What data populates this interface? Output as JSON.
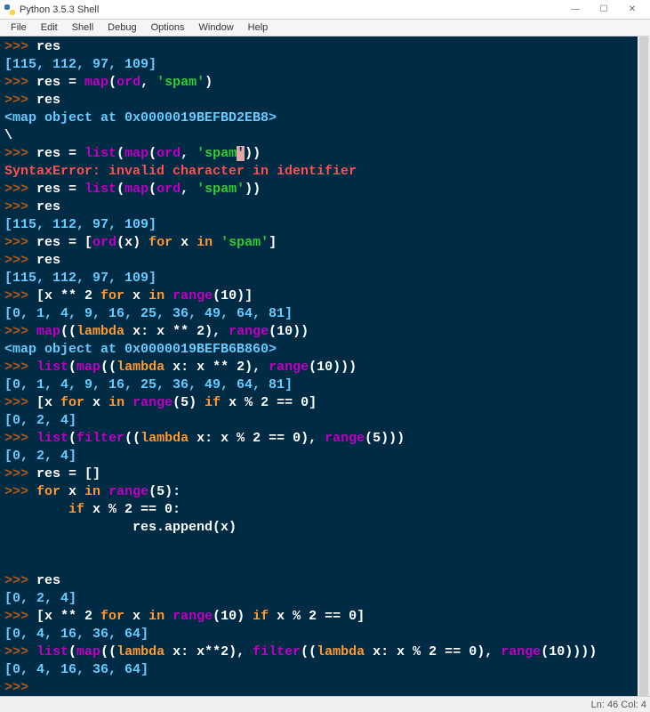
{
  "window": {
    "title": "Python 3.5.3 Shell",
    "min": "—",
    "max": "☐",
    "close": "✕"
  },
  "menu": {
    "file": "File",
    "edit": "Edit",
    "shell": "Shell",
    "debug": "Debug",
    "options": "Options",
    "window": "Window",
    "help": "Help"
  },
  "status": {
    "pos": "Ln: 46   Col: 4"
  },
  "lines": [
    [
      {
        "c": "p",
        "t": ">>> "
      },
      {
        "c": "id",
        "t": "res"
      }
    ],
    [
      {
        "c": "nn",
        "t": "[115, 112, 97, 109]"
      }
    ],
    [
      {
        "c": "p",
        "t": ">>> "
      },
      {
        "c": "id",
        "t": "res "
      },
      {
        "c": "op",
        "t": "= "
      },
      {
        "c": "fn",
        "t": "map"
      },
      {
        "c": "op",
        "t": "("
      },
      {
        "c": "fn",
        "t": "ord"
      },
      {
        "c": "op",
        "t": ", "
      },
      {
        "c": "st",
        "t": "'spam'"
      },
      {
        "c": "op",
        "t": ")"
      }
    ],
    [
      {
        "c": "p",
        "t": ">>> "
      },
      {
        "c": "id",
        "t": "res"
      }
    ],
    [
      {
        "c": "nn",
        "t": "<map object at 0x0000019BEFBD2EB8>"
      }
    ],
    [
      {
        "c": "id",
        "t": "\\"
      }
    ],
    [
      {
        "c": "p",
        "t": ">>> "
      },
      {
        "c": "id",
        "t": "res "
      },
      {
        "c": "op",
        "t": "= "
      },
      {
        "c": "fn",
        "t": "list"
      },
      {
        "c": "op",
        "t": "("
      },
      {
        "c": "fn",
        "t": "map"
      },
      {
        "c": "op",
        "t": "("
      },
      {
        "c": "fn",
        "t": "ord"
      },
      {
        "c": "op",
        "t": ", "
      },
      {
        "c": "st",
        "t": "'spam"
      },
      {
        "c": "cu",
        "t": "'"
      },
      {
        "c": "op",
        "t": "))"
      }
    ],
    [
      {
        "c": "er",
        "t": "SyntaxError: invalid character in identifier"
      }
    ],
    [
      {
        "c": "p",
        "t": ">>> "
      },
      {
        "c": "id",
        "t": "res "
      },
      {
        "c": "op",
        "t": "= "
      },
      {
        "c": "fn",
        "t": "list"
      },
      {
        "c": "op",
        "t": "("
      },
      {
        "c": "fn",
        "t": "map"
      },
      {
        "c": "op",
        "t": "("
      },
      {
        "c": "fn",
        "t": "ord"
      },
      {
        "c": "op",
        "t": ", "
      },
      {
        "c": "st",
        "t": "'spam'"
      },
      {
        "c": "op",
        "t": "))"
      }
    ],
    [
      {
        "c": "p",
        "t": ">>> "
      },
      {
        "c": "id",
        "t": "res"
      }
    ],
    [
      {
        "c": "nn",
        "t": "[115, 112, 97, 109]"
      }
    ],
    [
      {
        "c": "p",
        "t": ">>> "
      },
      {
        "c": "id",
        "t": "res "
      },
      {
        "c": "op",
        "t": "= ["
      },
      {
        "c": "fn",
        "t": "ord"
      },
      {
        "c": "op",
        "t": "(x) "
      },
      {
        "c": "kw",
        "t": "for"
      },
      {
        "c": "op",
        "t": " x "
      },
      {
        "c": "kw",
        "t": "in"
      },
      {
        "c": "op",
        "t": " "
      },
      {
        "c": "st",
        "t": "'spam'"
      },
      {
        "c": "op",
        "t": "]"
      }
    ],
    [
      {
        "c": "p",
        "t": ">>> "
      },
      {
        "c": "id",
        "t": "res"
      }
    ],
    [
      {
        "c": "nn",
        "t": "[115, 112, 97, 109]"
      }
    ],
    [
      {
        "c": "p",
        "t": ">>> "
      },
      {
        "c": "op",
        "t": "[x ** 2 "
      },
      {
        "c": "kw",
        "t": "for"
      },
      {
        "c": "op",
        "t": " x "
      },
      {
        "c": "kw",
        "t": "in"
      },
      {
        "c": "op",
        "t": " "
      },
      {
        "c": "fn",
        "t": "range"
      },
      {
        "c": "op",
        "t": "(10)]"
      }
    ],
    [
      {
        "c": "nn",
        "t": "[0, 1, 4, 9, 16, 25, 36, 49, 64, 81]"
      }
    ],
    [
      {
        "c": "p",
        "t": ">>> "
      },
      {
        "c": "fn",
        "t": "map"
      },
      {
        "c": "op",
        "t": "(("
      },
      {
        "c": "kw",
        "t": "lambda"
      },
      {
        "c": "op",
        "t": " x: x ** 2), "
      },
      {
        "c": "fn",
        "t": "range"
      },
      {
        "c": "op",
        "t": "(10))"
      }
    ],
    [
      {
        "c": "nn",
        "t": "<map object at 0x0000019BEFB6B860>"
      }
    ],
    [
      {
        "c": "p",
        "t": ">>> "
      },
      {
        "c": "fn",
        "t": "list"
      },
      {
        "c": "op",
        "t": "("
      },
      {
        "c": "fn",
        "t": "map"
      },
      {
        "c": "op",
        "t": "(("
      },
      {
        "c": "kw",
        "t": "lambda"
      },
      {
        "c": "op",
        "t": " x: x ** 2), "
      },
      {
        "c": "fn",
        "t": "range"
      },
      {
        "c": "op",
        "t": "(10)))"
      }
    ],
    [
      {
        "c": "nn",
        "t": "[0, 1, 4, 9, 16, 25, 36, 49, 64, 81]"
      }
    ],
    [
      {
        "c": "p",
        "t": ">>> "
      },
      {
        "c": "op",
        "t": "[x "
      },
      {
        "c": "kw",
        "t": "for"
      },
      {
        "c": "op",
        "t": " x "
      },
      {
        "c": "kw",
        "t": "in"
      },
      {
        "c": "op",
        "t": " "
      },
      {
        "c": "fn",
        "t": "range"
      },
      {
        "c": "op",
        "t": "(5) "
      },
      {
        "c": "kw",
        "t": "if"
      },
      {
        "c": "op",
        "t": " x % 2 == 0]"
      }
    ],
    [
      {
        "c": "nn",
        "t": "[0, 2, 4]"
      }
    ],
    [
      {
        "c": "p",
        "t": ">>> "
      },
      {
        "c": "fn",
        "t": "list"
      },
      {
        "c": "op",
        "t": "("
      },
      {
        "c": "fn",
        "t": "filter"
      },
      {
        "c": "op",
        "t": "(("
      },
      {
        "c": "kw",
        "t": "lambda"
      },
      {
        "c": "op",
        "t": " x: x % 2 == 0), "
      },
      {
        "c": "fn",
        "t": "range"
      },
      {
        "c": "op",
        "t": "(5)))"
      }
    ],
    [
      {
        "c": "nn",
        "t": "[0, 2, 4]"
      }
    ],
    [
      {
        "c": "p",
        "t": ">>> "
      },
      {
        "c": "id",
        "t": "res "
      },
      {
        "c": "op",
        "t": "= []"
      }
    ],
    [
      {
        "c": "p",
        "t": ">>> "
      },
      {
        "c": "kw",
        "t": "for"
      },
      {
        "c": "op",
        "t": " x "
      },
      {
        "c": "kw",
        "t": "in"
      },
      {
        "c": "op",
        "t": " "
      },
      {
        "c": "fn",
        "t": "range"
      },
      {
        "c": "op",
        "t": "(5):"
      }
    ],
    [
      {
        "c": "op",
        "t": "        "
      },
      {
        "c": "kw",
        "t": "if"
      },
      {
        "c": "op",
        "t": " x % 2 == 0:"
      }
    ],
    [
      {
        "c": "op",
        "t": "                res.append(x)"
      }
    ],
    [
      {
        "c": "op",
        "t": " "
      }
    ],
    [
      {
        "c": "op",
        "t": "                "
      }
    ],
    [
      {
        "c": "p",
        "t": ">>> "
      },
      {
        "c": "id",
        "t": "res"
      }
    ],
    [
      {
        "c": "nn",
        "t": "[0, 2, 4]"
      }
    ],
    [
      {
        "c": "p",
        "t": ">>> "
      },
      {
        "c": "op",
        "t": "[x ** 2 "
      },
      {
        "c": "kw",
        "t": "for"
      },
      {
        "c": "op",
        "t": " x "
      },
      {
        "c": "kw",
        "t": "in"
      },
      {
        "c": "op",
        "t": " "
      },
      {
        "c": "fn",
        "t": "range"
      },
      {
        "c": "op",
        "t": "(10) "
      },
      {
        "c": "kw",
        "t": "if"
      },
      {
        "c": "op",
        "t": " x % 2 == 0]"
      }
    ],
    [
      {
        "c": "nn",
        "t": "[0, 4, 16, 36, 64]"
      }
    ],
    [
      {
        "c": "p",
        "t": ">>> "
      },
      {
        "c": "fn",
        "t": "list"
      },
      {
        "c": "op",
        "t": "("
      },
      {
        "c": "fn",
        "t": "map"
      },
      {
        "c": "op",
        "t": "(("
      },
      {
        "c": "kw",
        "t": "lambda"
      },
      {
        "c": "op",
        "t": " x: x**2), "
      },
      {
        "c": "fn",
        "t": "filter"
      },
      {
        "c": "op",
        "t": "(("
      },
      {
        "c": "kw",
        "t": "lambda"
      },
      {
        "c": "op",
        "t": " x: x % 2 == 0), "
      },
      {
        "c": "fn",
        "t": "range"
      },
      {
        "c": "op",
        "t": "(10))))"
      }
    ],
    [
      {
        "c": "nn",
        "t": "[0, 4, 16, 36, 64]"
      }
    ],
    [
      {
        "c": "p",
        "t": ">>> "
      }
    ]
  ]
}
